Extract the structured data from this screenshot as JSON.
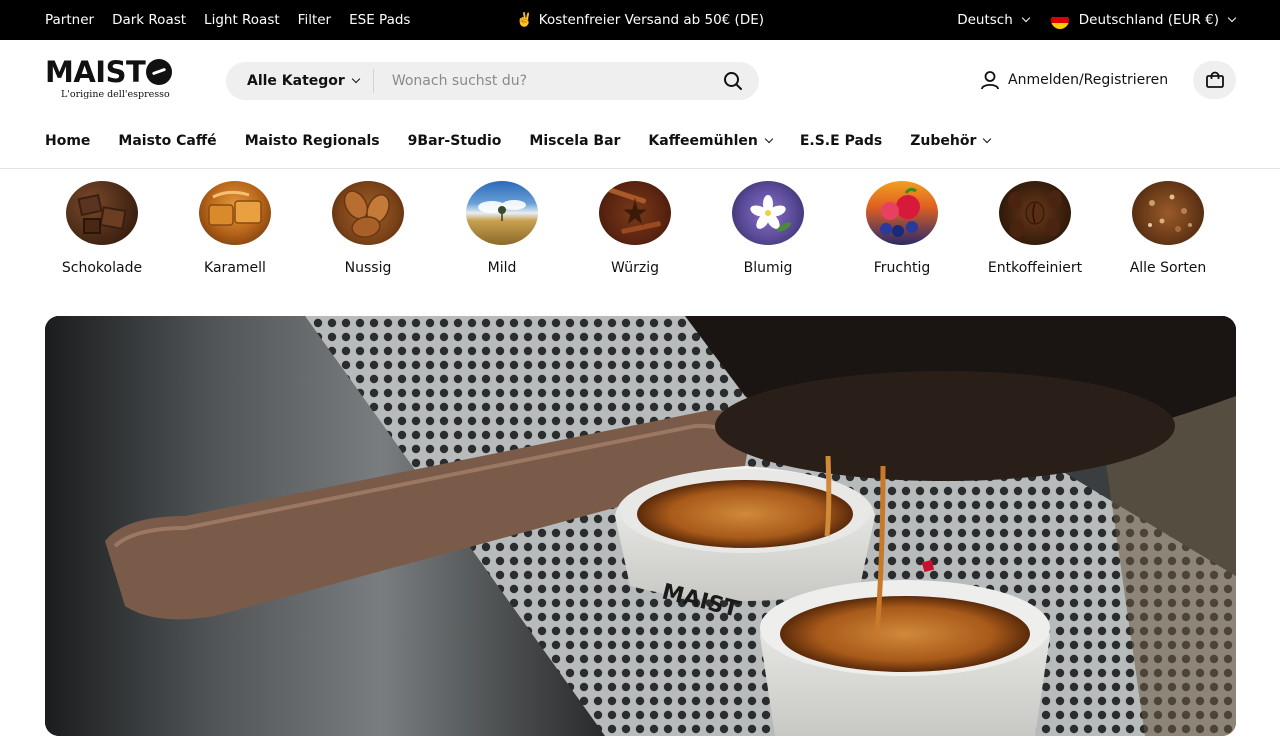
{
  "announcement": {
    "links": [
      "Partner",
      "Dark Roast",
      "Light Roast",
      "Filter",
      "ESE Pads"
    ],
    "promo_emoji": "✌️",
    "promo_text": "Kostenfreier Versand ab 50€ (DE)",
    "language": "Deutsch",
    "country": "Deutschland (EUR €)"
  },
  "header": {
    "logo_word": "MAIST",
    "logo_tagline": "L'origine dell'espresso",
    "search_category": "Alle Kategor",
    "search_placeholder": "Wonach suchst du?",
    "account_label": "Anmelden/Registrieren"
  },
  "nav": {
    "items": [
      {
        "label": "Home"
      },
      {
        "label": "Maisto Caffé"
      },
      {
        "label": "Maisto Regionals"
      },
      {
        "label": "9Bar-Studio"
      },
      {
        "label": "Miscela Bar"
      },
      {
        "label": "Kaffeemühlen"
      },
      {
        "label": "E.S.E Pads"
      },
      {
        "label": "Zubehör"
      }
    ]
  },
  "flavours": [
    {
      "label": "Schokolade"
    },
    {
      "label": "Karamell"
    },
    {
      "label": "Nussig"
    },
    {
      "label": "Mild"
    },
    {
      "label": "Würzig"
    },
    {
      "label": "Blumig"
    },
    {
      "label": "Fruchtig"
    },
    {
      "label": "Entkoffeiniert"
    },
    {
      "label": "Alle Sorten"
    }
  ],
  "colors": {
    "topbar_bg": "#000000",
    "search_bg": "#efefef",
    "text": "#111111",
    "divider": "#e3e3e3"
  }
}
